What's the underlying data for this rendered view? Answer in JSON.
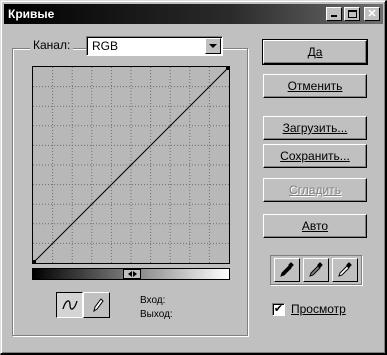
{
  "window": {
    "title": "Кривые",
    "controls": {
      "minimize": "minimize-icon",
      "maximize": "maximize-icon",
      "close": "close-icon"
    }
  },
  "channel": {
    "label": "Канал:",
    "value": "RGB"
  },
  "curve": {
    "grid_divisions": 10,
    "line": "diagonal"
  },
  "io": {
    "input_label": "Вход:",
    "output_label": "Выход:"
  },
  "buttons": {
    "ok": "Да",
    "cancel": "Отменить",
    "load": "Загрузить...",
    "save": "Сохранить...",
    "smooth": "Сгладить",
    "auto": "Авто"
  },
  "tools": {
    "curve_mode": "curve-icon",
    "pencil_mode": "pencil-icon",
    "droppers": [
      "black-eyedropper-icon",
      "gray-eyedropper-icon",
      "white-eyedropper-icon"
    ]
  },
  "preview": {
    "label": "Просмотр",
    "checked": true
  }
}
